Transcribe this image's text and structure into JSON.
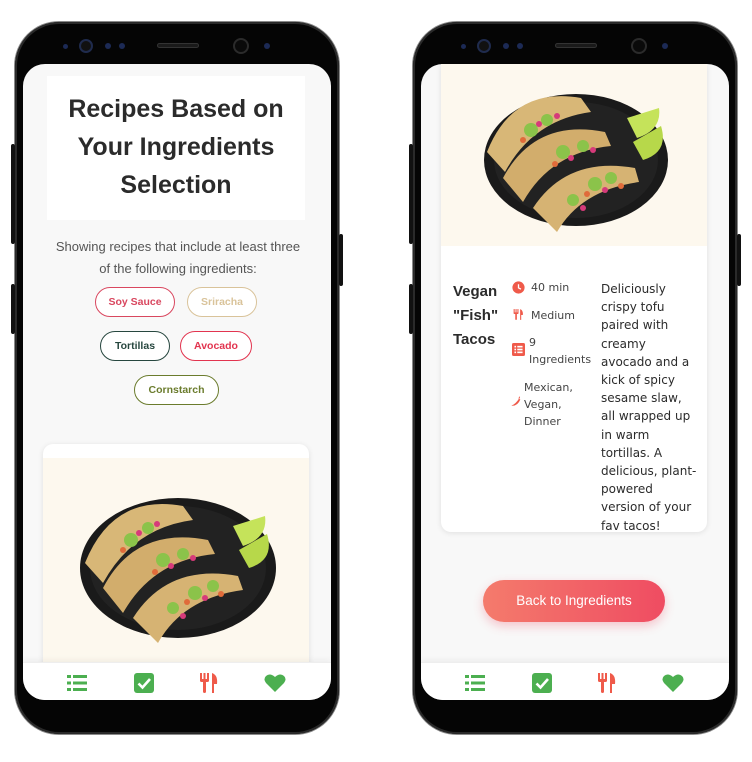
{
  "left_screen": {
    "heading": "Recipes Based on Your Ingredients Selection",
    "subtitle": "Showing recipes that include at least three of the following ingredients:",
    "ingredients": [
      {
        "label": "Soy Sauce",
        "color": "#d9475f"
      },
      {
        "label": "Sriracha",
        "color": "#d9c39a"
      },
      {
        "label": "Tortillas",
        "color": "#27473f"
      },
      {
        "label": "Avocado",
        "color": "#e2344f"
      },
      {
        "label": "Cornstarch",
        "color": "#6b7c2d"
      }
    ]
  },
  "right_screen": {
    "recipe": {
      "title": "Vegan \"Fish\" Tacos",
      "time": "40 min",
      "difficulty": "Medium",
      "ingredients_count": "9 Ingredients",
      "tags": "Mexican, Vegan, Dinner",
      "description": "Deliciously crispy tofu paired with creamy avocado and a kick of spicy sesame slaw, all wrapped up in warm tortillas. A delicious, plant-powered version of your fav tacos!"
    },
    "back_button": "Back to Ingredients"
  },
  "navbar": {
    "items": [
      {
        "icon": "list-icon",
        "color": "#4caf50"
      },
      {
        "icon": "checkbox-icon",
        "color": "#4caf50"
      },
      {
        "icon": "fork-knife-icon",
        "color": "#ef5a4a"
      },
      {
        "icon": "heart-icon",
        "color": "#4caf50"
      }
    ]
  },
  "colors": {
    "accent": "#ef4c62",
    "green": "#4caf50",
    "meta_icon": "#ef5a4a"
  }
}
